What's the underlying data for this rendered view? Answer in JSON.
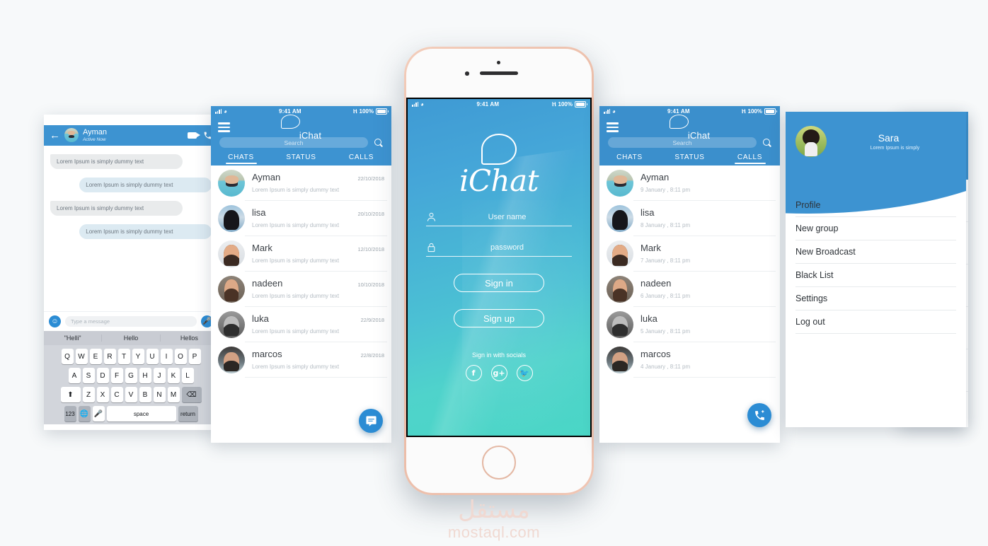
{
  "background_color": "#f7f9fa",
  "brand": {
    "name": "iChat",
    "accent": "#3d93d1",
    "fab_color": "#2b8cd4"
  },
  "status_bar": {
    "time": "9:41 AM",
    "battery": "100%",
    "wifi_icon": "wifi-icon",
    "signal_icon": "signal-bars-icon",
    "bluetooth_icon": "bluetooth-icon",
    "battery_icon": "battery-icon"
  },
  "login": {
    "logo_text": "Chat",
    "logo_bubble_icon": "speech-bubble-icon",
    "username": {
      "placeholder": "User name",
      "value": "",
      "icon": "user-icon"
    },
    "password": {
      "placeholder": "password",
      "value": "",
      "icon": "lock-icon"
    },
    "sign_in": "Sign in",
    "sign_up": "Sign up",
    "socials_label": "Sign in with socials",
    "socials": [
      {
        "name": "facebook-icon",
        "glyph": "f"
      },
      {
        "name": "google-plus-icon",
        "glyph": "g+"
      },
      {
        "name": "twitter-icon",
        "glyph": "✓"
      }
    ]
  },
  "conversation": {
    "back_icon": "back-arrow-icon",
    "contact": "Ayman",
    "status": "Active Now",
    "video_icon": "video-camera-icon",
    "call_icon": "phone-icon",
    "messages": [
      {
        "side": "them",
        "text": "Lorem Ipsum is simply dummy text"
      },
      {
        "side": "me",
        "text": "Lorem Ipsum is simply dummy text"
      },
      {
        "side": "them",
        "text": "Lorem Ipsum is simply dummy text"
      },
      {
        "side": "me",
        "text": "Lorem Ipsum is simply dummy text"
      }
    ],
    "composer": {
      "emoji_icon": "emoji-icon",
      "placeholder": "Type a message",
      "mic_icon": "microphone-icon"
    },
    "keyboard": {
      "predictions": [
        "\"Helli\"",
        "Hello",
        "Hellos"
      ],
      "row1": [
        "Q",
        "W",
        "E",
        "R",
        "T",
        "Y",
        "U",
        "I",
        "O",
        "P"
      ],
      "row2": [
        "A",
        "S",
        "D",
        "F",
        "G",
        "H",
        "J",
        "K",
        "L"
      ],
      "row3": [
        "Z",
        "X",
        "C",
        "V",
        "B",
        "N",
        "M"
      ],
      "shift_icon": "shift-icon",
      "backspace_icon": "backspace-icon",
      "numbers_key": "123",
      "globe_icon": "globe-icon",
      "mic_key_icon": "microphone-icon",
      "space_key": "space",
      "return_key": "return"
    }
  },
  "nav": {
    "menu_icon": "hamburger-menu-icon",
    "search_icon": "search-icon",
    "search_placeholder": "Search",
    "tabs": [
      "CHATS",
      "STATUS",
      "CALLS"
    ]
  },
  "chats_screen": {
    "active_tab": "CHATS",
    "fab_icon": "new-message-icon",
    "items": [
      {
        "name": "Ayman",
        "date": "22/10/2018",
        "preview": "Lorem Ipsum is simply dummy text",
        "avatar": "av1"
      },
      {
        "name": "lisa",
        "date": "20/10/2018",
        "preview": "Lorem Ipsum is simply dummy text",
        "avatar": "av2"
      },
      {
        "name": "Mark",
        "date": "12/10/2018",
        "preview": "Lorem Ipsum is simply dummy text",
        "avatar": "av3"
      },
      {
        "name": "nadeen",
        "date": "10/10/2018",
        "preview": "Lorem Ipsum is simply dummy text",
        "avatar": "av4"
      },
      {
        "name": "luka",
        "date": "22/9/2018",
        "preview": "Lorem Ipsum is simply dummy text",
        "avatar": "av5"
      },
      {
        "name": "marcos",
        "date": "22/8/2018",
        "preview": "Lorem Ipsum is simply dummy text",
        "avatar": "av6"
      }
    ]
  },
  "calls_screen": {
    "active_tab": "CALLS",
    "fab_icon": "new-call-icon",
    "items": [
      {
        "name": "Ayman",
        "time": "9 January , 8:11 pm",
        "avatar": "av1"
      },
      {
        "name": "lisa",
        "time": "8 January , 8:11 pm",
        "avatar": "av2"
      },
      {
        "name": "Mark",
        "time": "7 January , 8:11 pm",
        "avatar": "av3"
      },
      {
        "name": "nadeen",
        "time": "6 January , 8:11 pm",
        "avatar": "av4"
      },
      {
        "name": "luka",
        "time": "5 January , 8:11 pm",
        "avatar": "av5"
      },
      {
        "name": "marcos",
        "time": "4 January , 8:11 pm",
        "avatar": "av6"
      }
    ]
  },
  "drawer_screen": {
    "active_tab": "CALLS",
    "profile": {
      "name": "Sara",
      "subtitle": "Lorem Ipsum is simply",
      "avatar": "av-sara"
    },
    "menu": [
      "Profile",
      "New group",
      "New Broadcast",
      "Black List",
      "Settings",
      "Log out"
    ],
    "fab_icon": "new-call-icon"
  },
  "watermark": {
    "arabic": "مستقل",
    "latin": "mostaql.com"
  }
}
